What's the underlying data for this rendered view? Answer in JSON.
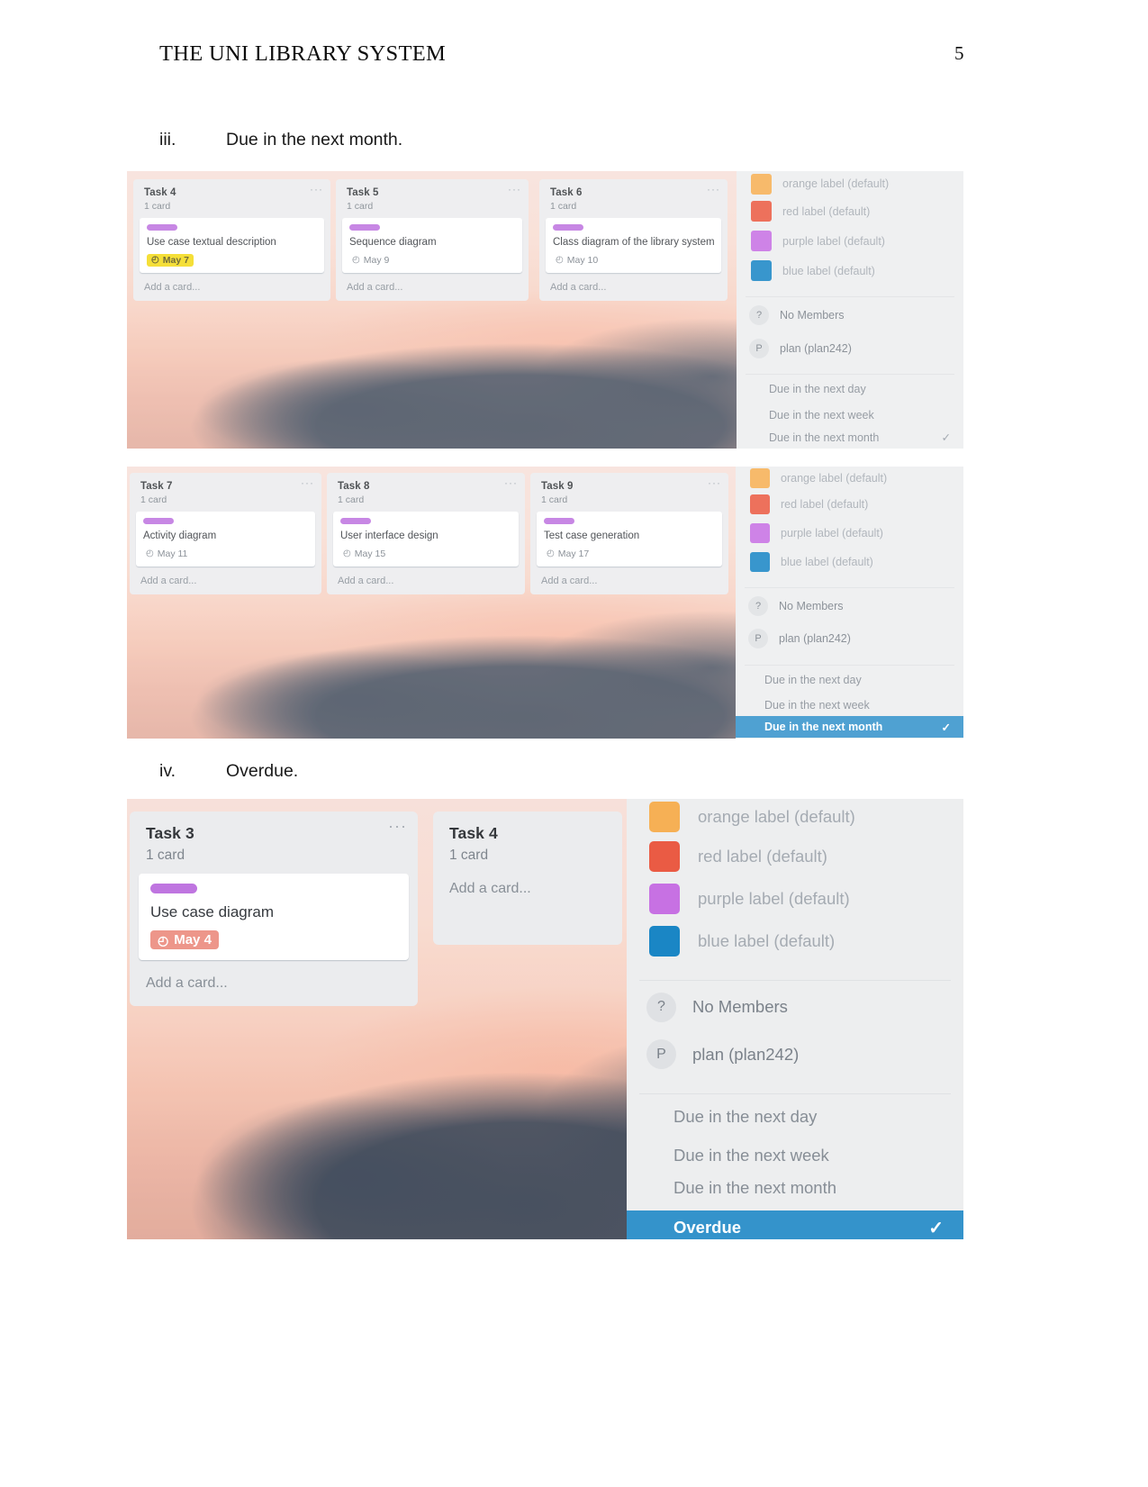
{
  "document": {
    "header_title": "THE UNI LIBRARY SYSTEM",
    "page_number": "5",
    "sections": [
      {
        "numeral": "iii.",
        "text": "Due in the next month."
      },
      {
        "numeral": "iv.",
        "text": "Overdue."
      }
    ]
  },
  "colors": {
    "label_orange": "#f5a742",
    "label_red": "#e8492f",
    "label_purple": "#c161e0",
    "label_blue": "#0079bf",
    "card_label_purple": "#b866dd",
    "due_yellow": "#f2d600",
    "due_overdue": "#eb8b7d",
    "selected_blue": "#1e87c6"
  },
  "filter_panel": {
    "labels": [
      {
        "name": "orange label (default)",
        "color": "#f5a742",
        "icon": "color-swatch-icon"
      },
      {
        "name": "red label (default)",
        "color": "#e8492f",
        "icon": "color-swatch-icon"
      },
      {
        "name": "purple label (default)",
        "color": "#c161e0",
        "icon": "color-swatch-icon"
      },
      {
        "name": "blue label (default)",
        "color": "#0079bf",
        "icon": "color-swatch-icon"
      }
    ],
    "members": [
      {
        "initial": "?",
        "name": "No Members"
      },
      {
        "initial": "P",
        "name": "plan (plan242)"
      }
    ],
    "due_filters": [
      "Due in the next day",
      "Due in the next week",
      "Due in the next month",
      "Overdue"
    ],
    "check_glyph": "✓"
  },
  "screenshot_1": {
    "selected_due_filter": "Due in the next month",
    "lists": [
      {
        "title": "Task 4",
        "count": "1 card",
        "menu": "···",
        "add_card": "Add a card...",
        "cards": [
          {
            "title": "Use case textual description",
            "due": "May 7",
            "due_state": "yellow",
            "clock": "◴"
          }
        ]
      },
      {
        "title": "Task 5",
        "count": "1 card",
        "menu": "···",
        "add_card": "Add a card...",
        "cards": [
          {
            "title": "Sequence diagram",
            "due": "May 9",
            "due_state": "plain",
            "clock": "◴"
          }
        ]
      },
      {
        "title": "Task 6",
        "count": "1 card",
        "menu": "···",
        "add_card": "Add a card...",
        "cards": [
          {
            "title": "Class diagram of the library system",
            "due": "May 10",
            "due_state": "plain",
            "clock": "◴"
          }
        ]
      }
    ]
  },
  "screenshot_2": {
    "selected_due_filter": "Due in the next month",
    "lists": [
      {
        "title": "Task 7",
        "count": "1 card",
        "menu": "···",
        "add_card": "Add a card...",
        "cards": [
          {
            "title": "Activity diagram",
            "due": "May 11",
            "due_state": "plain",
            "clock": "◴"
          }
        ]
      },
      {
        "title": "Task 8",
        "count": "1 card",
        "menu": "···",
        "add_card": "Add a card...",
        "cards": [
          {
            "title": "User interface design",
            "due": "May 15",
            "due_state": "plain",
            "clock": "◴"
          }
        ]
      },
      {
        "title": "Task 9",
        "count": "1 card",
        "menu": "···",
        "add_card": "Add a card...",
        "cards": [
          {
            "title": "Test case generation",
            "due": "May 17",
            "due_state": "plain",
            "clock": "◴"
          }
        ]
      }
    ]
  },
  "screenshot_3": {
    "selected_due_filter": "Overdue",
    "lists": [
      {
        "title": "Task 3",
        "count": "1 card",
        "menu": "···",
        "add_card": "Add a card...",
        "cards": [
          {
            "title": "Use case diagram",
            "due": "May 4",
            "due_state": "red",
            "clock": "◴"
          }
        ]
      },
      {
        "title": "Task 4",
        "count": "1 card",
        "menu": "",
        "add_card": "Add a card...",
        "cards": []
      }
    ]
  }
}
